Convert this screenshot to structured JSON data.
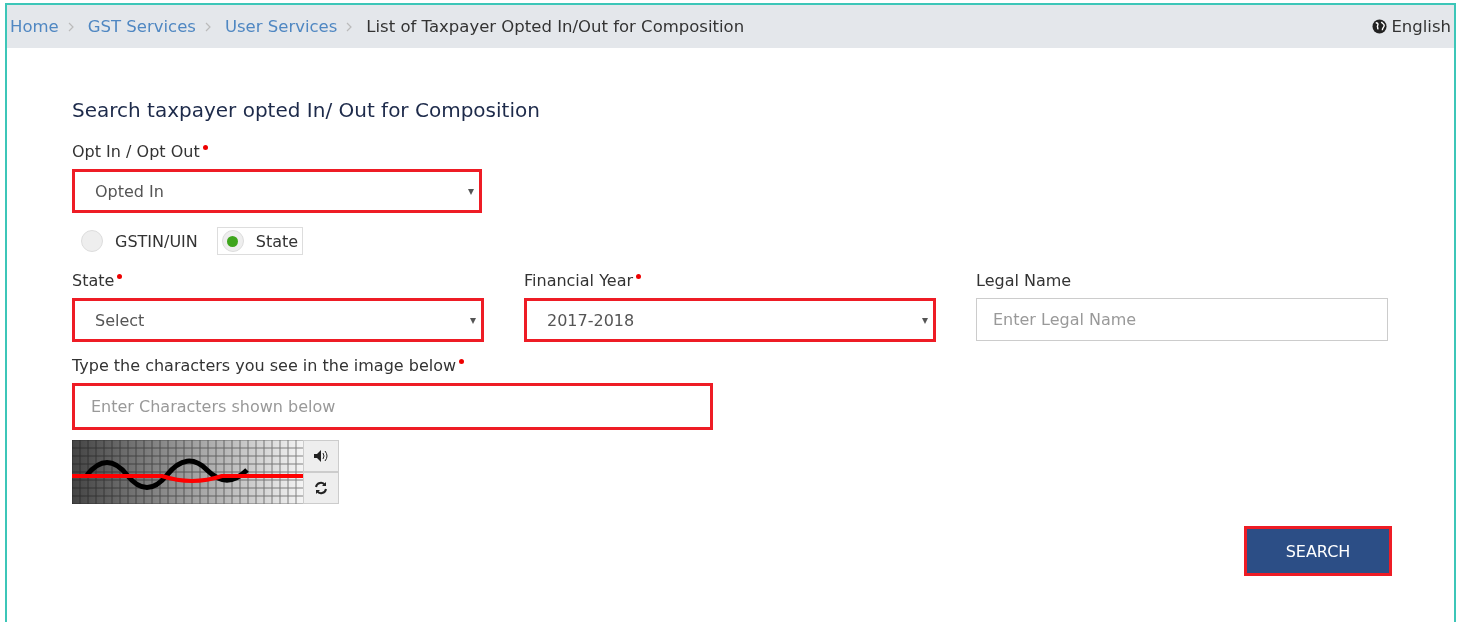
{
  "breadcrumb": {
    "items": [
      {
        "label": "Home"
      },
      {
        "label": "GST Services"
      },
      {
        "label": "User Services"
      }
    ],
    "current": "List of Taxpayer Opted In/Out for Composition"
  },
  "language": "English",
  "heading": "Search taxpayer opted In/ Out for Composition",
  "opt_field": {
    "label": "Opt In / Opt Out",
    "required": true,
    "value": "Opted In",
    "highlighted": true
  },
  "search_by": [
    {
      "label": "GSTIN/UIN",
      "selected": false
    },
    {
      "label": "State",
      "selected": true
    }
  ],
  "fields": [
    {
      "kind": "select",
      "label": "State",
      "required": true,
      "value": "Select",
      "highlighted": true
    },
    {
      "kind": "select",
      "label": "Financial Year",
      "required": true,
      "value": "2017-2018",
      "highlighted": true
    },
    {
      "kind": "input",
      "label": "Legal Name",
      "required": false,
      "placeholder": "Enter Legal Name",
      "highlighted": false
    }
  ],
  "captcha": {
    "label": "Type the characters you see in the image below",
    "required": true,
    "placeholder": "Enter Characters shown below",
    "highlighted": true
  },
  "search_button": {
    "label": "SEARCH",
    "highlighted": true
  }
}
